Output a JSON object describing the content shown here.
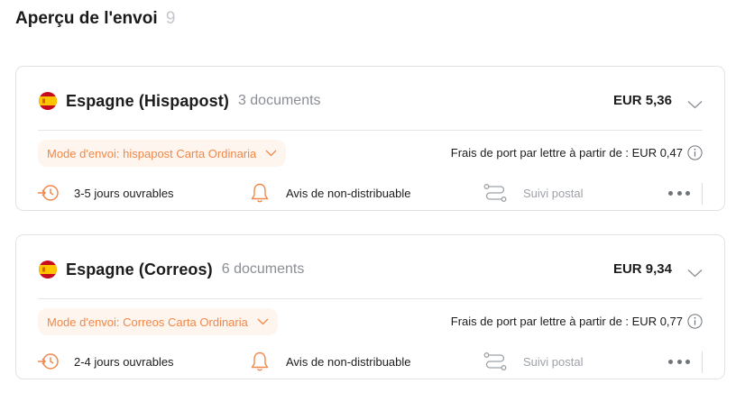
{
  "header": {
    "title": "Aperçu de l'envoi",
    "count": "9"
  },
  "shipments": [
    {
      "country": "Espagne (Hispapost)",
      "docs": "3 documents",
      "price": "EUR 5,36",
      "mode": "Mode d'envoi: hispapost Carta Ordinaria",
      "frais": "Frais de port par lettre à partir de : EUR 0,47",
      "delay": "3-5 jours ouvrables",
      "notice": "Avis de non-distribuable",
      "tracking": "Suivi postal"
    },
    {
      "country": "Espagne (Correos)",
      "docs": "6 documents",
      "price": "EUR 9,34",
      "mode": "Mode d'envoi: Correos Carta Ordinaria",
      "frais": "Frais de port par lettre à partir de : EUR 0,77",
      "delay": "2-4 jours ouvrables",
      "notice": "Avis de non-distribuable",
      "tracking": "Suivi postal"
    }
  ],
  "colors": {
    "accent": "#f0884a",
    "accent_bg": "#fef5ee",
    "muted": "#9ea2a8",
    "border": "#e1e3e6"
  },
  "icons": {
    "flag": "spain-flag-icon",
    "expand": "chevron-down-icon",
    "info": "info-icon",
    "delay": "clock-arrow-icon",
    "notice": "bell-icon",
    "tracking": "route-icon",
    "more": "more-horizontal-icon"
  }
}
